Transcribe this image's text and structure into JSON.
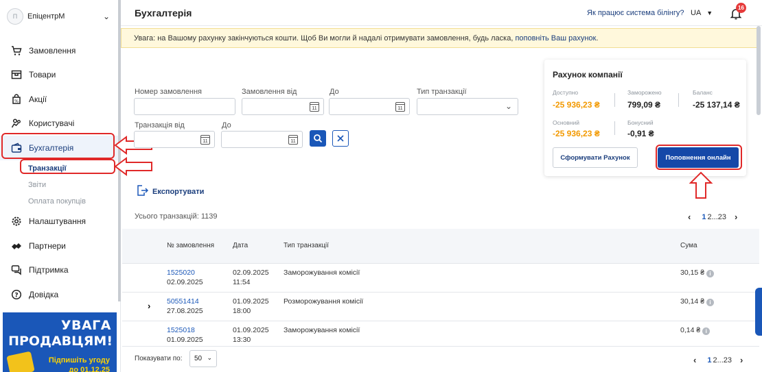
{
  "company": {
    "avatar_initials": "П",
    "name": "ЕпіцентрМ"
  },
  "sidebar": {
    "items": [
      {
        "label": "Замовлення",
        "icon": "cart-icon"
      },
      {
        "label": "Товари",
        "icon": "box-icon"
      },
      {
        "label": "Акції",
        "icon": "tag-icon"
      },
      {
        "label": "Користувачі",
        "icon": "users-icon"
      },
      {
        "label": "Бухгалтерія",
        "icon": "wallet-icon",
        "active": true
      },
      {
        "label": "Налаштування",
        "icon": "gear-icon"
      },
      {
        "label": "Партнери",
        "icon": "handshake-icon"
      },
      {
        "label": "Підтримка",
        "icon": "chat-icon"
      },
      {
        "label": "Довідка",
        "icon": "help-icon"
      }
    ],
    "subitems": [
      {
        "label": "Транзакції",
        "active": true
      },
      {
        "label": "Звіти"
      },
      {
        "label": "Оплата покупців"
      }
    ]
  },
  "banner": {
    "line1": "УВАГА",
    "line2": "ПРОДАВЦЯМ!",
    "line3": "Підпишіть угоду",
    "line4": "до 01.12.25"
  },
  "header": {
    "title": "Бухгалтерія",
    "billing_link": "Як працює система білінгу?",
    "lang": "UA",
    "notifications": "16"
  },
  "warning": {
    "text": "Увага: на Вашому рахунку закінчуються кошти. Щоб Ви могли й надалі отримувати замовлення, будь ласка, ",
    "link": "поповніть Ваш рахунок",
    "end": "."
  },
  "filters": {
    "order_number": "Номер замовлення",
    "order_from": "Замовлення від",
    "to": "До",
    "transaction_type": "Тип транзакції",
    "transaction_from": "Транзакція від",
    "to2": "До",
    "calendar_day": "11"
  },
  "export_label": "Експортувати",
  "account": {
    "title": "Рахунок компанії",
    "available_label": "Доступно",
    "available": "-25 936,23 ₴",
    "frozen_label": "Заморожено",
    "frozen": "799,09 ₴",
    "balance_label": "Баланс",
    "balance": "-25 137,14 ₴",
    "main_label": "Основний",
    "main": "-25 936,23 ₴",
    "bonus_label": "Бонусний",
    "bonus": "-0,91 ₴",
    "invoice_button": "Сформувати Рахунок",
    "topup_button": "Поповнення онлайн"
  },
  "summary": {
    "total": "Усього транзакцій: 1139"
  },
  "pagination": {
    "current": "1",
    "rest": "2...23"
  },
  "table": {
    "headers": {
      "order": "№ замовлення",
      "date": "Дата",
      "type": "Тип транзакції",
      "amount": "Сума"
    },
    "rows": [
      {
        "order": "1525020",
        "order_date": "02.09.2025",
        "date": "02.09.2025",
        "time": "11:54",
        "type": "Заморожування комісії",
        "amount": "30,15 ₴",
        "expandable": false
      },
      {
        "order": "50551414",
        "order_date": "27.08.2025",
        "date": "01.09.2025",
        "time": "18:00",
        "type": "Розморожування комісії",
        "amount": "30,14 ₴",
        "expandable": true
      },
      {
        "order": "1525018",
        "order_date": "01.09.2025",
        "date": "01.09.2025",
        "time": "13:30",
        "type": "Заморожування комісії",
        "amount": "0,14 ₴",
        "expandable": false
      }
    ]
  },
  "footer": {
    "show_label": "Показувати по:",
    "per_page": "50"
  },
  "colors": {
    "accent": "#1a57b8",
    "orange": "#f29900",
    "annotation": "#e02828"
  }
}
